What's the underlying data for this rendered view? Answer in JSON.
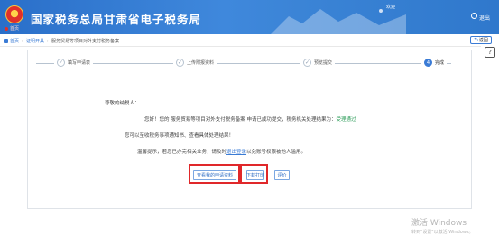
{
  "header": {
    "site_title": "国家税务总局甘肃省电子税务局",
    "home_link": "首页",
    "welcome": "欢迎",
    "logout": "退出"
  },
  "breadcrumb": {
    "items": [
      "首页",
      "证明开具",
      "服务贸易等项目对外支付税务备案"
    ]
  },
  "back_button": "返回",
  "qr_button": "?",
  "steps": [
    {
      "number": "✓",
      "label": "填写申请表"
    },
    {
      "number": "✓",
      "label": "上传附报资料"
    },
    {
      "number": "✓",
      "label": "预览提交"
    },
    {
      "number": "4",
      "label": "完成"
    }
  ],
  "content": {
    "greeting": "尊敬的纳税人：",
    "line1_prefix": "您好！您的 服务贸易等项目对外支付税务备案 申请已成功提交，税务机关处理结果为：",
    "line1_status": "受理通过",
    "line2": "您可以至收税务事项通知书、查看具体处理结果！",
    "line3_prefix": "温馨提示，若您已办完相关业务，请及时",
    "line3_link": "退出登录",
    "line3_suffix": "以免账号权限被他人滥用。"
  },
  "buttons": {
    "view_label": "查看我的申请资料",
    "download_label": "下载打印",
    "eval_label": "评价"
  },
  "watermark": {
    "line1": "激活 Windows",
    "line2": "转到\"设置\"以激活 Windows。"
  },
  "colors": {
    "header_blue": "#3f88dc",
    "link_blue": "#3a7bd5",
    "status_green": "#2e9d5a",
    "highlight_red": "#e0282a"
  }
}
